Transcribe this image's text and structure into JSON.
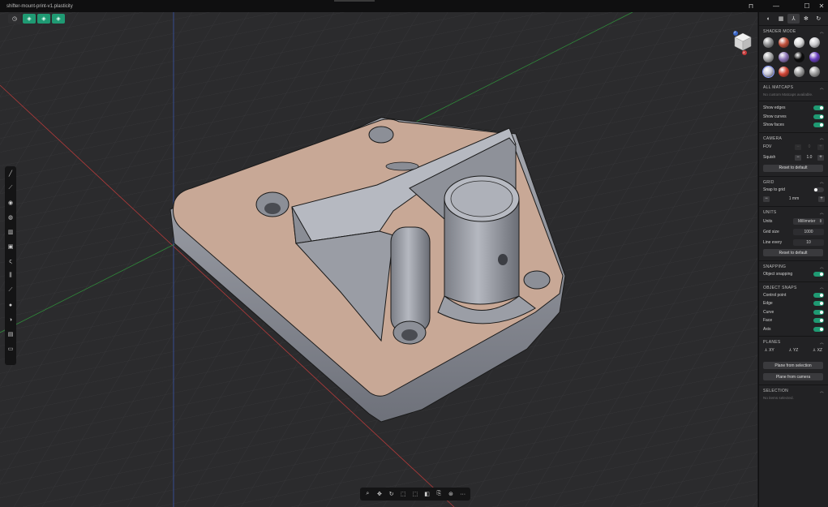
{
  "window": {
    "title": "shifter-mount-print-v1.plasticity",
    "controls": {
      "pin": "⊓",
      "minimize": "—",
      "maximize": "☐",
      "close": "✕"
    }
  },
  "top_toolbar": {
    "items": [
      {
        "icon": "sync-icon",
        "glyph": "◷"
      },
      {
        "icon": "solid-view-icon",
        "glyph": "◈"
      },
      {
        "icon": "wire-view-icon",
        "glyph": "◈"
      },
      {
        "icon": "face-view-icon",
        "glyph": "◈"
      }
    ]
  },
  "left_tools": [
    {
      "icon": "line-icon",
      "glyph": "╱"
    },
    {
      "icon": "curve-icon",
      "glyph": "⟋"
    },
    {
      "icon": "circle-icon",
      "glyph": "◉"
    },
    {
      "icon": "sphere-icon",
      "glyph": "◍"
    },
    {
      "icon": "extrude-icon",
      "glyph": "▥"
    },
    {
      "icon": "box-icon",
      "glyph": "▣"
    },
    {
      "icon": "spiral-icon",
      "glyph": "ς"
    },
    {
      "icon": "mirror-icon",
      "glyph": "⫼"
    },
    {
      "icon": "cut-icon",
      "glyph": "⟋"
    },
    {
      "icon": "fillet-icon",
      "glyph": "●"
    },
    {
      "icon": "boolean-icon",
      "glyph": "◑"
    },
    {
      "icon": "offset-icon",
      "glyph": "▤"
    },
    {
      "icon": "shell-icon",
      "glyph": "▭"
    }
  ],
  "bottom_toolbar": [
    {
      "icon": "zoom-icon",
      "glyph": "⌕"
    },
    {
      "icon": "move-icon",
      "glyph": "✥"
    },
    {
      "icon": "rotate-icon",
      "glyph": "↻"
    },
    {
      "icon": "frame-icon",
      "glyph": "⬚"
    },
    {
      "icon": "isolate-icon",
      "glyph": "⬚"
    },
    {
      "icon": "hide-icon",
      "glyph": "◧"
    },
    {
      "icon": "clip-icon",
      "glyph": "⎘"
    },
    {
      "icon": "xray-icon",
      "glyph": "⊛"
    },
    {
      "icon": "more-icon",
      "glyph": "···"
    }
  ],
  "navcube": {
    "x_label": "X",
    "z_label": "Z"
  },
  "panel": {
    "tabs": [
      {
        "icon": "globe-icon",
        "glyph": "◐"
      },
      {
        "icon": "layers-icon",
        "glyph": "▦"
      },
      {
        "icon": "axes-icon",
        "glyph": "⅄"
      },
      {
        "icon": "settings-icon",
        "glyph": "✻"
      },
      {
        "icon": "refresh-icon",
        "glyph": "↻"
      }
    ],
    "shader_mode": {
      "title": "SHADER MODE",
      "matcaps": [
        "#8d8d8f",
        "#c0503b",
        "#d8d8d8",
        "#c9c9cc",
        "#a6a6a8",
        "#8a72b5",
        "#0c0c0c",
        "#6a3fc0",
        "#c8c8d8",
        "#d14535",
        "#9a9a9a",
        "#9a9a9a"
      ]
    },
    "all_matcaps": {
      "title": "ALL MATCAPS",
      "empty": "No custom Matcaps available."
    },
    "display": [
      {
        "label": "Show edges",
        "on": true
      },
      {
        "label": "Show curves",
        "on": true
      },
      {
        "label": "Show faces",
        "on": true
      }
    ],
    "camera": {
      "title": "CAMERA",
      "fov_label": "FOV",
      "fov_minus": "−",
      "fov_value": "0",
      "fov_plus": "+",
      "squish_label": "Squish",
      "squish_minus": "−",
      "squish_value": "1.0",
      "squish_plus": "+",
      "reset": "Reset to default"
    },
    "grid": {
      "title": "GRID",
      "snap_label": "Snap to grid",
      "snap_on": false,
      "minus": "−",
      "value": "1 mm",
      "plus": "+"
    },
    "units": {
      "title": "UNITS",
      "units_label": "Units",
      "units_value": "Millimeter",
      "grid_size_label": "Grid size",
      "grid_size_value": "1000",
      "line_every_label": "Line every",
      "line_every_value": "10",
      "reset": "Reset to default"
    },
    "snapping": {
      "title": "SNAPPING",
      "object_label": "Object snapping",
      "on": true
    },
    "object_snaps": {
      "title": "OBJECT SNAPS",
      "items": [
        {
          "label": "Control point",
          "on": true
        },
        {
          "label": "Edge",
          "on": true
        },
        {
          "label": "Curve",
          "on": true
        },
        {
          "label": "Face",
          "on": true
        },
        {
          "label": "Axis",
          "on": true
        }
      ]
    },
    "planes": {
      "title": "PLANES",
      "items": [
        {
          "label": "XY"
        },
        {
          "label": "YZ"
        },
        {
          "label": "XZ"
        }
      ],
      "from_selection": "Plane from selection",
      "from_camera": "Plane from camera"
    },
    "selection": {
      "title": "SELECTION",
      "empty": "No items selected."
    }
  },
  "colors": {
    "accent": "#1f9a73",
    "model_face": "#c8a896",
    "model_side": "#8d9098"
  }
}
